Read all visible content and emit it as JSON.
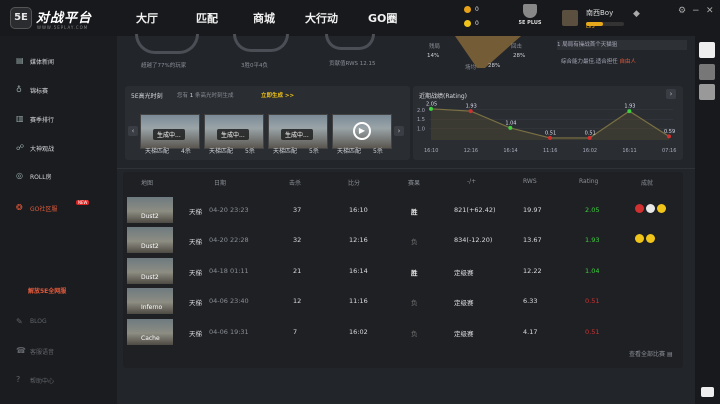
{
  "app": {
    "logo_badge": "5E",
    "logo_title": "对战平台",
    "logo_sub": "WWW.5EPLAY.COM"
  },
  "nav": [
    "大厅",
    "匹配",
    "商城",
    "大行动",
    "GO圈"
  ],
  "currency": [
    {
      "value": "0",
      "color": "#e8a21a"
    },
    {
      "value": "0",
      "color": "#f0c419"
    }
  ],
  "plus_badge": "5E PLUS",
  "user": {
    "name": "南西Boy",
    "level": "LV5",
    "level_progress": 0.45
  },
  "window_controls": [
    "−",
    "□",
    "✕",
    "⚙"
  ],
  "sidebar": {
    "items": [
      {
        "label": "媒体新闻",
        "icon": "news-icon"
      },
      {
        "label": "锦标赛",
        "icon": "trophy-icon"
      },
      {
        "label": "赛季排行",
        "icon": "ranking-icon"
      },
      {
        "label": "大神观战",
        "icon": "watch-icon"
      },
      {
        "label": "ROLL房",
        "icon": "roll-icon"
      },
      {
        "label": "GO社区服",
        "icon": "community-icon",
        "badge": "NEW"
      }
    ],
    "promo": "解放5E全网服",
    "bottom_items": [
      {
        "label": "BLOG",
        "icon": "blog-icon"
      },
      {
        "label": "客服语音",
        "icon": "service-icon"
      },
      {
        "label": "帮助中心",
        "icon": "help-icon"
      }
    ]
  },
  "stats_top": {
    "beat_text": "超越了77%的玩家",
    "record_text": "3胜0平4负",
    "rws_text": "贡献值RWS 12.15",
    "radar": {
      "label_a": "残局",
      "value_a": "14%",
      "label_b": "回击",
      "value_b": "28%",
      "label_c": "场均",
      "value_c": "28%"
    },
    "info_rows": [
      "1 局局有操战首个天猫狙",
      "综合能力最佳,适合担任"
    ],
    "info_highlight": "自由人"
  },
  "highlights": {
    "title": "5E高光时刻",
    "subtitle_prefix": "您有",
    "subtitle_count": "1",
    "subtitle_suffix": "条高光时刻生成",
    "generate_label": "立即生成 >>",
    "clips": [
      {
        "status": "生成中...",
        "mode": "天梯匹配",
        "kills": "4杀"
      },
      {
        "status": "生成中...",
        "mode": "天梯匹配",
        "kills": "5杀"
      },
      {
        "status": "生成中...",
        "mode": "天梯匹配",
        "kills": "5杀"
      },
      {
        "status": "",
        "mode": "天梯匹配",
        "kills": "5杀"
      }
    ]
  },
  "chart_data": {
    "type": "line",
    "title": "近期战绩(Rating)",
    "x": [
      "16:10",
      "12:16",
      "16:14",
      "11:16",
      "16:02",
      "16:11",
      "07:16"
    ],
    "values": [
      2.05,
      1.93,
      1.04,
      0.51,
      0.51,
      1.93,
      0.59
    ],
    "y_ticks": [
      "2.0",
      "1.5",
      "1.0"
    ],
    "ylim": [
      0.4,
      2.2
    ],
    "grid": true,
    "line_color": "#7a7043",
    "point_colors": [
      "#3fcf3f",
      "#d03030",
      "#3fcf3f",
      "#d03030",
      "#d03030",
      "#3fcf3f",
      "#d03030"
    ]
  },
  "table": {
    "headers": [
      "地图",
      "日期",
      "击杀",
      "比分",
      "赛果",
      "-/+",
      "RWS",
      "Rating",
      "成就"
    ],
    "rows": [
      {
        "map": "Dust2",
        "mode": "天梯",
        "date": "04-20 23:23",
        "kills": "37",
        "score": "16:10",
        "result": "胜",
        "elo": "821(+62.42)",
        "rws": "19.97",
        "rating": "2.05",
        "rating_color": "#3fcf3f",
        "medals": [
          "#d03030",
          "#e8e8e8",
          "#f0c419"
        ]
      },
      {
        "map": "Dust2",
        "mode": "天梯",
        "date": "04-20 22:28",
        "kills": "32",
        "score": "12:16",
        "result": "负",
        "elo": "834(-12.20)",
        "rws": "13.67",
        "rating": "1.93",
        "rating_color": "#3fcf3f",
        "medals": [
          "#f0c419",
          "#f0c419"
        ]
      },
      {
        "map": "Dust2",
        "mode": "天梯",
        "date": "04-18 01:11",
        "kills": "21",
        "score": "16:14",
        "result": "胜",
        "elo": "定级赛",
        "rws": "12.22",
        "rating": "1.04",
        "rating_color": "#3fcf3f",
        "medals": []
      },
      {
        "map": "Inferno",
        "mode": "天梯",
        "date": "04-06 23:40",
        "kills": "12",
        "score": "11:16",
        "result": "负",
        "elo": "定级赛",
        "rws": "6.33",
        "rating": "0.51",
        "rating_color": "#d03030",
        "medals": []
      },
      {
        "map": "Cache",
        "mode": "天梯",
        "date": "04-06 19:31",
        "kills": "7",
        "score": "16:02",
        "result": "负",
        "elo": "定级赛",
        "rws": "4.17",
        "rating": "0.51",
        "rating_color": "#d03030",
        "medals": []
      }
    ],
    "footer_link": "查看全部比赛"
  }
}
